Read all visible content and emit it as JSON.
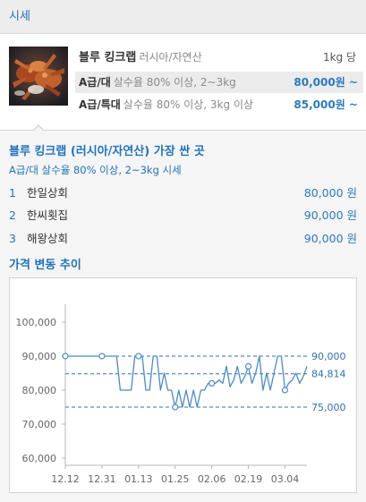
{
  "header": {
    "title": "시세"
  },
  "product": {
    "name": "블루 킹크랩",
    "origin": "러시아/자연산",
    "unit": "1kg 당",
    "grades": [
      {
        "grade": "A급/대",
        "desc": "살수율 80% 이상, 2~3kg",
        "price": "80,000원 ~"
      },
      {
        "grade": "A급/특대",
        "desc": "살수율 80% 이상, 3kg 이상",
        "price": "85,000원 ~"
      }
    ]
  },
  "cheapest": {
    "title": "블루 킹크랩 (러시아/자연산) 가장 싼 곳",
    "subtitle": "A급/대 살수율 80% 이상, 2~3kg 시세",
    "stores": [
      {
        "rank": "1",
        "name": "한일상회",
        "price": "80,000 원"
      },
      {
        "rank": "2",
        "name": "한씨횟집",
        "price": "90,000 원"
      },
      {
        "rank": "3",
        "name": "해왕상회",
        "price": "90,000 원"
      }
    ]
  },
  "trend": {
    "title": "가격 변동 추이"
  },
  "colors": {
    "accent": "#1f73bd",
    "price": "#2a7ac0",
    "series": "#4b8acb",
    "reference": "#2f6fb0",
    "axis": "#b5b5b5"
  },
  "chart_data": {
    "type": "line",
    "x_tick_labels": [
      "12.12",
      "12.31",
      "01.13",
      "01.25",
      "02.06",
      "02.19",
      "03.04"
    ],
    "y_ticks": [
      {
        "value": 100000,
        "label": "100,000"
      },
      {
        "value": 90000,
        "label": "90,000"
      },
      {
        "value": 80000,
        "label": "80,000"
      },
      {
        "value": 70000,
        "label": "70,000"
      },
      {
        "value": 60000,
        "label": "60,000"
      }
    ],
    "ylim": [
      60000,
      100000
    ],
    "grid": false,
    "reference_lines": [
      {
        "value": 90000,
        "label": "90,000"
      },
      {
        "value": 84814,
        "label": "84,814"
      },
      {
        "value": 75000,
        "label": "75,000"
      }
    ],
    "values": [
      90000,
      90000,
      90000,
      90000,
      90000,
      90000,
      90000,
      90000,
      90000,
      90000,
      90000,
      90000,
      90000,
      90000,
      90000,
      80000,
      80000,
      80000,
      80000,
      90000,
      90000,
      90000,
      80000,
      80000,
      90000,
      90000,
      80000,
      85000,
      80000,
      80000,
      75000,
      80000,
      75000,
      80000,
      75000,
      80000,
      75000,
      80000,
      80000,
      82000,
      82000,
      82000,
      83000,
      82000,
      87000,
      81000,
      83000,
      87000,
      82000,
      84000,
      87000,
      82000,
      85000,
      90000,
      80000,
      85000,
      80000,
      85000,
      90000,
      90000,
      80000,
      82000,
      83000,
      85000,
      82000,
      84000,
      87000
    ]
  }
}
